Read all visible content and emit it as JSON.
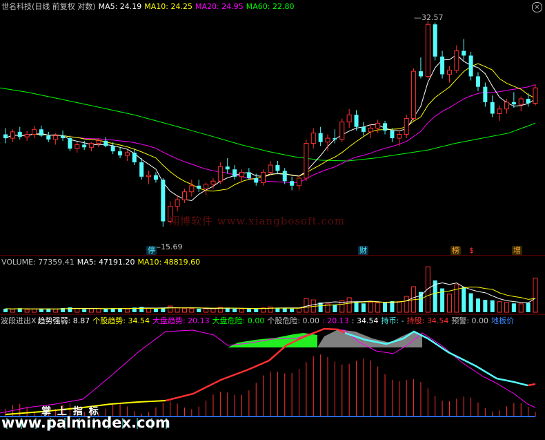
{
  "header": {
    "title": "世名科技(日线 前复权 对数)",
    "ma5": "MA5: 24.19",
    "ma10": "MA10: 24.25",
    "ma20": "MA20: 24.95",
    "ma60": "MA60: 22.80"
  },
  "volume_header": {
    "label": "VOLUME: 77359.41",
    "ma5": "MA5: 47191.20",
    "ma10": "MA10: 48819.60"
  },
  "indicator_header": {
    "name": "波段进出X",
    "trend": "趋势强弱: 8.87",
    "stock_trend": "个股趋势: 34.54",
    "market_trend": "大盘趋势: 20.13",
    "market_risk": "大盘危险: 0.00",
    "stock_risk": "个股危险: 0.00",
    "v1": ": 20.13",
    "v2": ": 34.54",
    "hold_coin": "持币: -",
    "hold_stock": "持股: 34.54",
    "warn": "预警: 0.00",
    "floor": "地板价"
  },
  "annotations": {
    "high": "32.57",
    "low": "15.69",
    "tag_stop": "停",
    "tag_fin": "财",
    "tag_rank": "榜",
    "tag_s": "$",
    "tag_add": "增"
  },
  "watermark": {
    "main": "翔博软件 www.xiangbosoft.com",
    "bottom_cn": "掌 上 指 标",
    "bottom_url": "www.palmindex.com"
  },
  "colors": {
    "up": "#ff3030",
    "down": "#54fcfc",
    "ma5": "#ffffff",
    "ma10": "#ffff00",
    "ma20": "#ff00ff",
    "ma60": "#00ff00"
  },
  "chart_data": {
    "type": "candlestick",
    "title": "世名科技(日线 前复权 对数)",
    "ylim": [
      14.5,
      34
    ],
    "candles": [
      [
        21.9,
        22.4,
        21.2,
        21.6
      ],
      [
        21.6,
        22.3,
        21.3,
        22.1
      ],
      [
        22.1,
        22.5,
        21.5,
        21.7
      ],
      [
        21.7,
        22.2,
        21.4,
        21.9
      ],
      [
        21.9,
        22.6,
        21.6,
        22.3
      ],
      [
        22.3,
        22.6,
        21.7,
        21.8
      ],
      [
        21.8,
        22.1,
        21.3,
        21.5
      ],
      [
        21.5,
        22.0,
        21.1,
        21.8
      ],
      [
        21.8,
        22.2,
        21.4,
        21.6
      ],
      [
        21.6,
        21.8,
        20.6,
        20.8
      ],
      [
        20.8,
        21.3,
        20.5,
        21.1
      ],
      [
        21.1,
        21.4,
        20.7,
        20.9
      ],
      [
        20.9,
        21.3,
        20.6,
        21.2
      ],
      [
        21.2,
        21.6,
        20.9,
        21.4
      ],
      [
        21.4,
        21.7,
        20.9,
        21.0
      ],
      [
        21.0,
        21.3,
        20.4,
        20.6
      ],
      [
        20.6,
        20.9,
        20.1,
        20.3
      ],
      [
        20.3,
        20.7,
        19.9,
        20.5
      ],
      [
        20.5,
        20.8,
        19.6,
        19.8
      ],
      [
        19.8,
        20.1,
        18.6,
        18.8
      ],
      [
        18.8,
        19.2,
        18.3,
        18.9
      ],
      [
        18.9,
        19.1,
        18.4,
        18.6
      ],
      [
        18.6,
        18.7,
        15.69,
        16.0
      ],
      [
        16.0,
        17.2,
        15.9,
        16.9
      ],
      [
        16.9,
        17.6,
        16.6,
        17.3
      ],
      [
        17.3,
        18.0,
        17.1,
        17.8
      ],
      [
        17.8,
        18.6,
        17.5,
        18.2
      ],
      [
        18.2,
        18.6,
        17.8,
        18.0
      ],
      [
        18.0,
        18.4,
        17.6,
        18.3
      ],
      [
        18.3,
        18.7,
        18.0,
        18.5
      ],
      [
        18.5,
        19.8,
        18.3,
        19.5
      ],
      [
        19.5,
        20.1,
        19.0,
        19.3
      ],
      [
        19.3,
        19.6,
        18.6,
        18.8
      ],
      [
        18.8,
        19.3,
        18.4,
        19.1
      ],
      [
        19.1,
        19.4,
        18.6,
        18.7
      ],
      [
        18.7,
        19.0,
        18.2,
        18.4
      ],
      [
        18.4,
        19.3,
        18.2,
        19.1
      ],
      [
        19.1,
        19.9,
        18.9,
        19.6
      ],
      [
        19.6,
        19.9,
        19.0,
        19.2
      ],
      [
        19.2,
        19.4,
        18.3,
        18.5
      ],
      [
        18.5,
        18.8,
        17.9,
        18.2
      ],
      [
        18.2,
        18.9,
        17.9,
        18.7
      ],
      [
        18.7,
        21.5,
        18.5,
        21.2
      ],
      [
        21.2,
        22.4,
        20.8,
        22.0
      ],
      [
        22.0,
        22.5,
        21.0,
        21.3
      ],
      [
        21.3,
        21.9,
        20.6,
        21.6
      ],
      [
        21.6,
        22.3,
        21.2,
        21.5
      ],
      [
        21.5,
        23.2,
        21.3,
        22.9
      ],
      [
        22.9,
        24.0,
        22.4,
        23.5
      ],
      [
        23.5,
        23.9,
        22.2,
        22.5
      ],
      [
        22.5,
        22.9,
        21.8,
        22.1
      ],
      [
        22.1,
        22.7,
        21.6,
        22.4
      ],
      [
        22.4,
        23.1,
        22.0,
        22.8
      ],
      [
        22.8,
        23.0,
        21.9,
        22.2
      ],
      [
        22.2,
        22.4,
        21.3,
        21.6
      ],
      [
        21.6,
        22.2,
        21.0,
        21.9
      ],
      [
        21.9,
        23.5,
        21.6,
        23.2
      ],
      [
        23.2,
        27.8,
        23.0,
        27.5
      ],
      [
        27.5,
        28.9,
        26.8,
        27.0
      ],
      [
        27.0,
        33.0,
        26.8,
        32.57
      ],
      [
        32.57,
        32.8,
        28.6,
        29.0
      ],
      [
        29.0,
        29.6,
        26.8,
        27.2
      ],
      [
        27.2,
        28.0,
        26.4,
        27.6
      ],
      [
        27.6,
        30.2,
        27.3,
        29.6
      ],
      [
        29.6,
        30.9,
        28.6,
        29.1
      ],
      [
        29.1,
        29.5,
        26.6,
        27.0
      ],
      [
        27.0,
        27.4,
        25.6,
        26.0
      ],
      [
        26.0,
        26.4,
        24.2,
        24.6
      ],
      [
        24.6,
        25.2,
        23.3,
        23.6
      ],
      [
        23.6,
        24.3,
        23.0,
        24.0
      ],
      [
        24.0,
        24.9,
        23.6,
        24.6
      ],
      [
        24.6,
        25.5,
        24.1,
        24.4
      ],
      [
        24.4,
        25.1,
        23.8,
        24.9
      ],
      [
        24.9,
        25.4,
        24.2,
        24.5
      ],
      [
        24.5,
        26.2,
        24.3,
        25.9
      ]
    ],
    "ma60": [
      25.9,
      25.5,
      25.0,
      24.5,
      24.0,
      23.5,
      22.9,
      22.3,
      21.7,
      21.1,
      20.6,
      20.2,
      19.95,
      19.9,
      20.1,
      20.4,
      20.7,
      21.2,
      21.6,
      22.0,
      22.8
    ],
    "volume_ylim": [
      0,
      105000
    ],
    "volume": [
      8000,
      7000,
      9000,
      6500,
      7500,
      8000,
      7200,
      6800,
      9500,
      11000,
      8500,
      7000,
      7800,
      8200,
      7600,
      9000,
      8800,
      7300,
      10500,
      12000,
      9000,
      8000,
      9500,
      14000,
      10000,
      9000,
      8500,
      8000,
      7800,
      8200,
      11000,
      9500,
      8000,
      7600,
      7800,
      8400,
      9800,
      12000,
      10000,
      9000,
      8200,
      9600,
      31000,
      28000,
      22000,
      19000,
      17500,
      26000,
      33000,
      24000,
      20000,
      22000,
      21000,
      23500,
      25000,
      24000,
      36000,
      58000,
      46000,
      103000,
      72000,
      54000,
      41000,
      62000,
      57000,
      43000,
      31000,
      28000,
      27000,
      24000,
      22000,
      20000,
      19000,
      21000,
      77359.41
    ],
    "indicator_ylim": [
      0,
      100
    ]
  }
}
